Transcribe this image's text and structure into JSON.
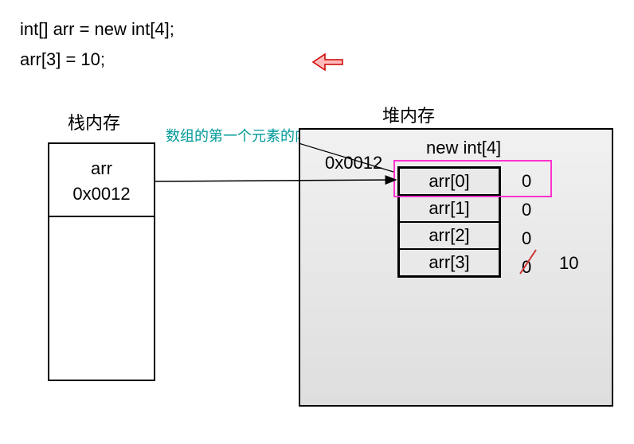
{
  "code": {
    "line1": "int[] arr = new int[4];",
    "line2": "arr[3] = 10;"
  },
  "annotation": "数组的第一个元素的内存地址",
  "stack": {
    "title": "栈内存",
    "var": "arr",
    "addr": "0x0012"
  },
  "heap": {
    "title": "堆内存",
    "addr": "0x0012",
    "new_expr": "new int[4]",
    "cells": [
      "arr[0]",
      "arr[1]",
      "arr[2]",
      "arr[3]"
    ],
    "initial_values": [
      "0",
      "0",
      "0",
      "0"
    ],
    "updated_value": "10"
  }
}
